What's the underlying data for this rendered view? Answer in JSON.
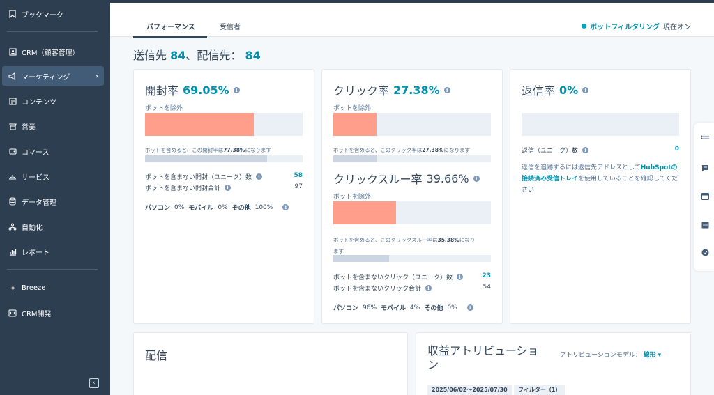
{
  "sidebar": {
    "items": [
      {
        "label": "ブックマーク",
        "icon": "bookmark-icon"
      },
      {
        "label": "CRM（顧客管理）",
        "icon": "contacts-icon"
      },
      {
        "label": "マーケティング",
        "icon": "megaphone-icon"
      },
      {
        "label": "コンテンツ",
        "icon": "content-icon"
      },
      {
        "label": "営業",
        "icon": "sales-icon"
      },
      {
        "label": "コマース",
        "icon": "commerce-icon"
      },
      {
        "label": "サービス",
        "icon": "service-icon"
      },
      {
        "label": "データ管理",
        "icon": "database-icon"
      },
      {
        "label": "自動化",
        "icon": "automation-icon"
      },
      {
        "label": "レポート",
        "icon": "reports-icon"
      },
      {
        "label": "Breeze",
        "icon": "breeze-icon"
      },
      {
        "label": "CRM開発",
        "icon": "developer-icon"
      }
    ]
  },
  "tabs": {
    "performance": "パフォーマンス",
    "recipients": "受信者"
  },
  "bot_filter": {
    "label": "ボットフィルタリング",
    "status": "現在オン"
  },
  "summary": {
    "sent_label": "送信先",
    "sent_count": "84",
    "delivered_label": "、配信先：",
    "delivered_count": "84"
  },
  "open_card": {
    "title": "開封率",
    "rate": "69.05%",
    "exclude_label": "ボットを除外",
    "bar_fraction": 0.6905,
    "incl_prefix": "ボットを含めると、この開封率は",
    "incl_value": "77.38%",
    "incl_suffix": "になります",
    "incl_fraction": 0.7738,
    "unique_label": "ボットを含まない開封（ユニーク）数",
    "unique_value": "58",
    "total_label": "ボットを含まない開封合計",
    "total_value": "97",
    "desktop_label": "パソコン",
    "desktop_value": "0%",
    "mobile_label": "モバイル",
    "mobile_value": "0%",
    "other_label": "その他",
    "other_value": "100%"
  },
  "click_card": {
    "title": "クリック率",
    "rate": "27.38%",
    "exclude_label": "ボットを除外",
    "bar_fraction": 0.2738,
    "incl_prefix": "ボットを含めると、このクリック率は",
    "incl_value": "27.38%",
    "incl_suffix": "になります",
    "incl_fraction": 0.2738,
    "ctr_title": "クリックスルー率",
    "ctr_rate": "39.66%",
    "ctr_exclude_label": "ボットを除外",
    "ctr_bar_fraction": 0.3966,
    "ctr_incl_prefix": "ボットを含めると、このクリックスルー率は",
    "ctr_incl_value": "35.38%",
    "ctr_incl_suffix1": "になり",
    "ctr_incl_suffix2": "ます",
    "ctr_incl_fraction": 0.3538,
    "unique_label": "ボットを含まないクリック（ユニーク）数",
    "unique_value": "23",
    "total_label": "ボットを含まないクリック合計",
    "total_value": "54",
    "desktop_label": "パソコン",
    "desktop_value": "96%",
    "mobile_label": "モバイル",
    "mobile_value": "4%",
    "other_label": "その他",
    "other_value": "0%"
  },
  "reply_card": {
    "title": "返信率",
    "rate": "0%",
    "unique_label": "返信（ユニーク）数",
    "unique_value": "0",
    "note_prefix": "返信を追跡するには返信先アドレスとして",
    "note_link": "HubSpotの接続済み受信トレイ",
    "note_suffix": "を使用していることを確認してください"
  },
  "delivery_card": {
    "title": "配信"
  },
  "attribution_card": {
    "title_line1": "収益アトリビューショ",
    "title_line2": "ン",
    "model_label": "アトリビューションモデル：",
    "model_value": "線形",
    "date_range": "2025/06/02〜2025/07/30",
    "filter_label": "フィルター（1）"
  },
  "side_tools": [
    "apps-grid-icon",
    "chat-icon",
    "browser-icon",
    "calendar-icon",
    "check-badge-icon"
  ]
}
